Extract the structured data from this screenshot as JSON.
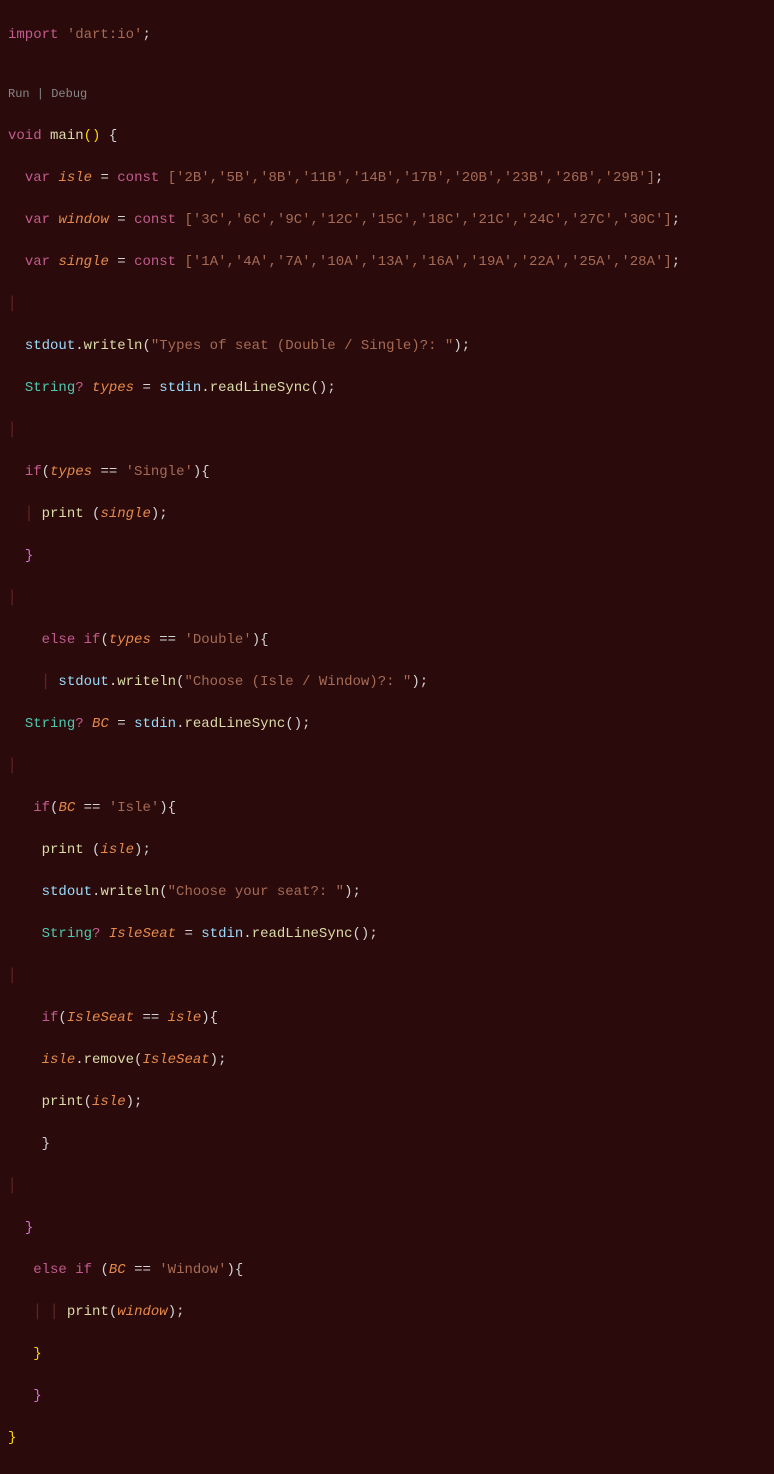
{
  "import_stmt": {
    "kw": "import",
    "lib": "'dart:io'",
    "semi": ";"
  },
  "codelens": {
    "run": "Run",
    "sep": " | ",
    "debug": "Debug"
  },
  "main_decl": {
    "void": "void",
    "main": "main",
    "paren": "()",
    "brace": " {"
  },
  "decl": {
    "var": "var",
    "const": "const",
    "eq": " = ",
    "isle": "isle",
    "window": "window",
    "single": "single",
    "isle_arr": "['2B','5B','8B','11B','14B','17B','20B','23B','26B','29B']",
    "window_arr": "['3C','6C','9C','12C','15C','18C','21C','24C','27C','30C']",
    "single_arr": "['1A','4A','7A','10A','13A','16A','19A','22A','25A','28A']",
    "semi": ";"
  },
  "io": {
    "stdout": "stdout",
    "stdin": "stdin",
    "writeln": "writeln",
    "readLineSync": "readLineSync",
    "prompt_types": "\"Types of seat (Double / Single)?: \"",
    "prompt_choose": "\"Choose (Isle / Window)?: \"",
    "prompt_seat": "\"Choose your seat?: \""
  },
  "vars": {
    "String": "String",
    "q": "?",
    "types": "types",
    "BC": "BC",
    "IsleSeat": "IsleSeat"
  },
  "kw": {
    "if": "if",
    "else": "else",
    "print": "print",
    "remove": "remove"
  },
  "lits": {
    "Single": "'Single'",
    "Double": "'Double'",
    "Isle": "'Isle'",
    "Window": "'Window'"
  }
}
